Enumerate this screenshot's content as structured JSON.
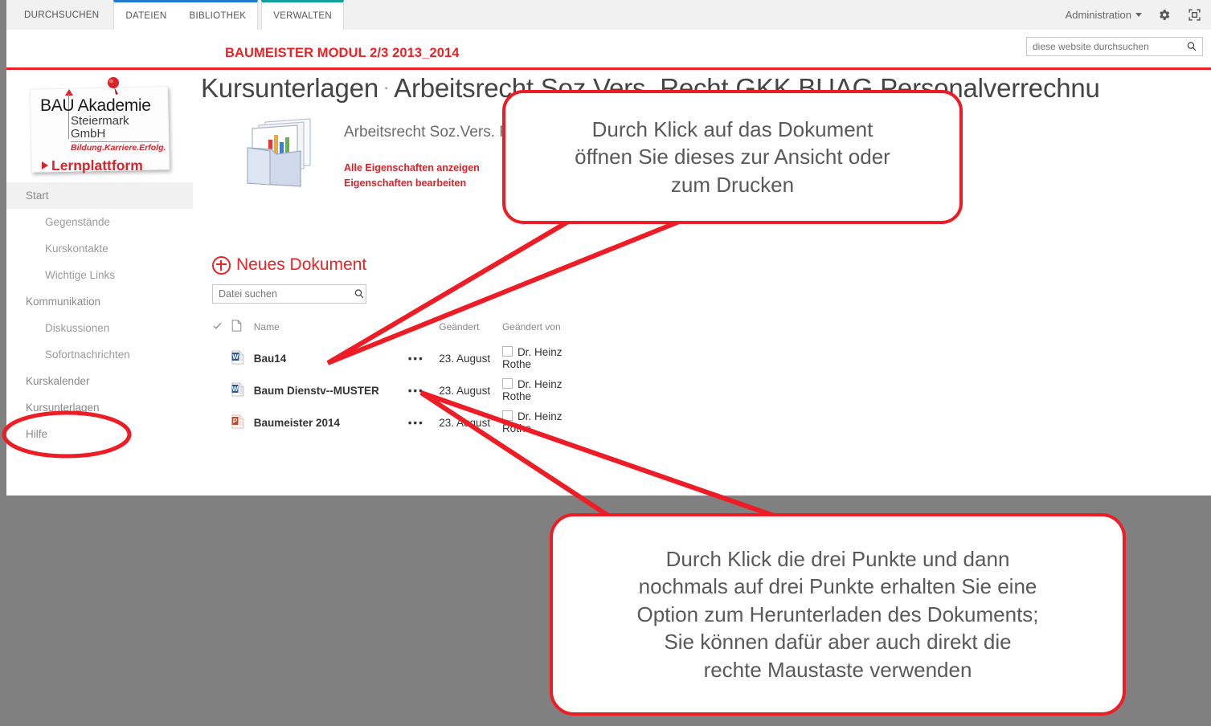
{
  "suitebar": {
    "tabs": [
      {
        "label": "DURCHSUCHEN",
        "group": "none"
      },
      {
        "label": "DATEIEN",
        "group": "blue"
      },
      {
        "label": "BIBLIOTHEK",
        "group": "blue"
      },
      {
        "label": "VERWALTEN",
        "group": "teal"
      }
    ],
    "admin_label": "Administration",
    "gear_icon": "gear-icon",
    "focus_icon": "focus-on-content-icon"
  },
  "site_search": {
    "placeholder": "diese website durchsuchen",
    "value": "",
    "icon": "search-icon"
  },
  "site": {
    "title": "BAUMEISTER MODUL 2/3 2013_2014",
    "title_color": "#ec2224",
    "rule_color": "#ec2224"
  },
  "logo": {
    "line1": "BAU Akademie",
    "line1_a": "BAU",
    "line1_b": "Akademie",
    "line2": "Steiermark GmbH",
    "line3": "Bildung.Karriere.Erfolg.",
    "line4": "Lernplattform",
    "pin_icon": "pushpin-icon",
    "accent": "#d8232a"
  },
  "sidebar": {
    "items": [
      {
        "label": "Start",
        "level": "top",
        "selected": true
      },
      {
        "label": "Gegenstände",
        "level": "sub"
      },
      {
        "label": "Kurskontakte",
        "level": "sub"
      },
      {
        "label": "Wichtige Links",
        "level": "sub"
      },
      {
        "label": "Kommunikation",
        "level": "top"
      },
      {
        "label": "Diskussionen",
        "level": "sub"
      },
      {
        "label": "Sofortnachrichten",
        "level": "sub"
      },
      {
        "label": "Kurskalender",
        "level": "top"
      },
      {
        "label": "Kursunterlagen",
        "level": "top",
        "circled": true
      },
      {
        "label": "Hilfe",
        "level": "top"
      }
    ]
  },
  "heading": {
    "crumb": "Kursunterlagen",
    "separator": "·",
    "title": "Arbeitsrecht Soz.Vers. Recht GKK BUAG Personalverrechnu"
  },
  "doc_properties": {
    "icon": "magazine-file-icon",
    "title": "Arbeitsrecht Soz.Vers. Recht GKK BUAG Personalverrechnung",
    "link_show_all": "Alle Eigenschaften anzeigen",
    "link_edit": "Eigenschaften bearbeiten"
  },
  "documents": {
    "new_doc_label": "Neues Dokument",
    "new_doc_icon": "plus-circle-icon",
    "search": {
      "placeholder": "Datei suchen",
      "value": "",
      "icon": "search-icon"
    },
    "columns": {
      "check": "✓",
      "type_icon": "document-outline-icon",
      "name": "Name",
      "modified": "Geändert",
      "modified_by": "Geändert von"
    },
    "rows": [
      {
        "icon": "word-document-icon",
        "name": "Bau14",
        "dots": "•••",
        "modified": "23. August",
        "modified_by": "Dr. Heinz Rothe"
      },
      {
        "icon": "word-document-icon",
        "name": "Baum Dienstv--MUSTER",
        "dots": "•••",
        "modified": "23. August",
        "modified_by": "Dr. Heinz Rothe"
      },
      {
        "icon": "powerpoint-document-icon",
        "name": "Baumeister 2014",
        "dots": "•••",
        "modified": "23. August",
        "modified_by": "Dr. Heinz Rothe"
      }
    ]
  },
  "annotations": {
    "color": "#ee1c25",
    "callout_top": {
      "line1": "Durch Klick auf das Dokument",
      "line2": "öffnen Sie dieses zur Ansicht oder",
      "line3": "zum Drucken"
    },
    "callout_bottom": {
      "line1": "Durch Klick die drei Punkte und dann",
      "line2": "nochmals auf drei Punkte erhalten Sie eine",
      "line3": "Option zum Herunterladen des Dokuments;",
      "line4": "Sie können dafür aber auch direkt die",
      "line5": "rechte Maustaste verwenden"
    },
    "circled_sidebar_item": "Kursunterlagen"
  }
}
